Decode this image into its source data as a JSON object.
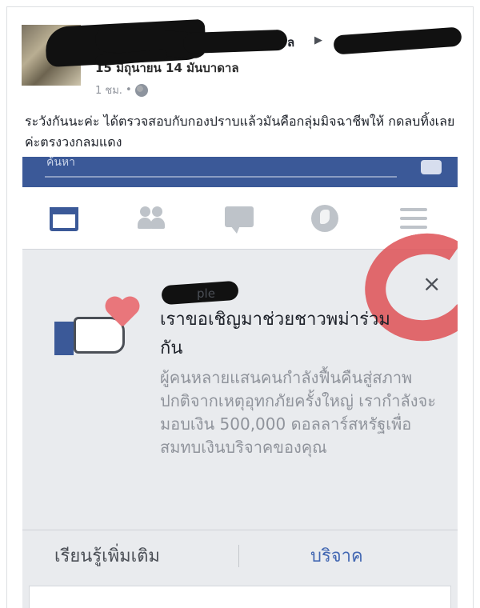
{
  "post": {
    "name_tail": "ล",
    "subline": "15 มิถุนายน 14 มันบาดาล",
    "time": "1 ชม.",
    "separator": "•",
    "text": "ระวังกันนะค่ะ ได้ตรวจสอบกับกองปราบแล้วมันคือกลุ่มมิจฉาชีพให้ กดลบทิ้งเลยค่ะตรงวงกลมแดง"
  },
  "screenshot": {
    "topbar_text": "ค้นหา",
    "page_name_tail": "ple",
    "close_glyph": "×",
    "headline": "เราขอเชิญมาช่วยชาวพม่าร่วมกัน",
    "body": "ผู้คนหลายแสนคนกำลังฟื้นคืนสู่สภาพปกติจากเหตุอุทกภัยครั้งใหญ่ เรากำลังจะมอบเงิน 500,000 ดอลลาร์สหรัฐเพื่อสมทบเงินบริจาคของคุณ",
    "learn_more": "เรียนรู้เพิ่มเติม",
    "donate": "บริจาค"
  },
  "colors": {
    "facebook_blue": "#3b5998",
    "link_blue": "#4267b2",
    "red_circle": "#e05a5f",
    "heart": "#e9767b"
  }
}
